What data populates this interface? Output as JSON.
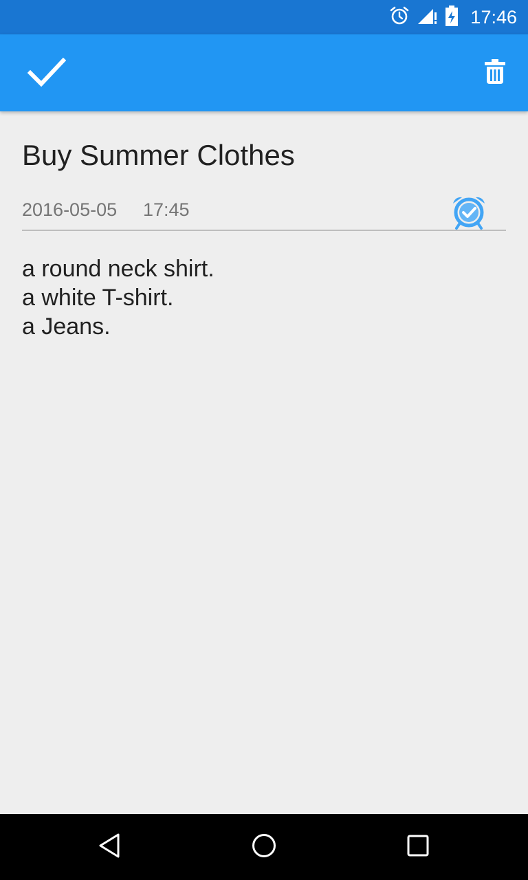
{
  "status_bar": {
    "time": "17:46",
    "icons": [
      "alarm-icon",
      "signal-icon",
      "battery-icon"
    ]
  },
  "app_bar": {
    "background": "#2196f3",
    "left_action_icon": "check-icon",
    "right_action_icon": "trash-icon"
  },
  "note": {
    "title": "Buy Summer Clothes",
    "reminder": {
      "date": "2016-05-05",
      "time": "17:45",
      "icon": "alarm-check-icon",
      "icon_color": "#42a5f5"
    },
    "body_lines": [
      "a round neck shirt.",
      "a white T-shirt.",
      "a Jeans."
    ]
  },
  "nav_bar": {
    "buttons": [
      "back-icon",
      "home-icon",
      "recents-icon"
    ]
  }
}
